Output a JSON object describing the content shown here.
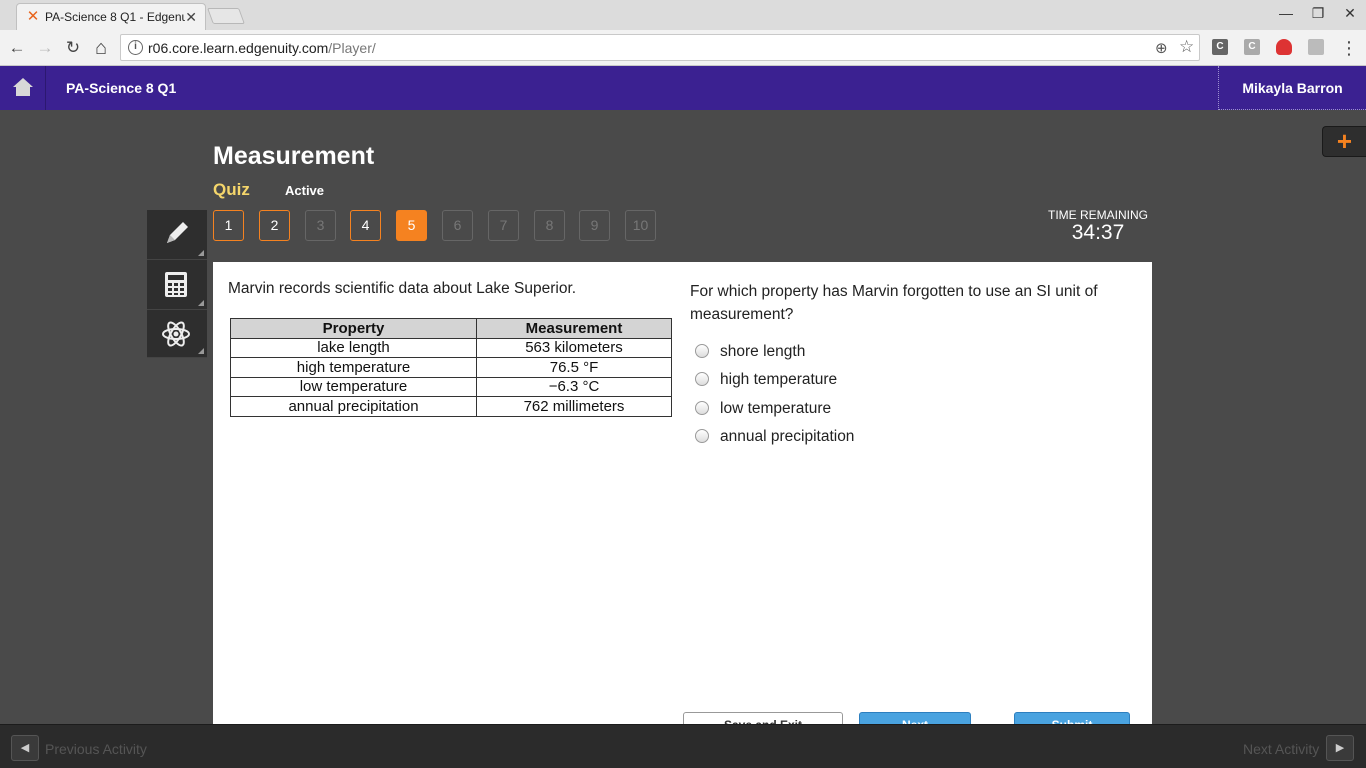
{
  "browser": {
    "tab_title": "PA-Science 8 Q1 - Edgenuity",
    "tab_close": "✕",
    "url_host": "r06.core.learn.edgenuity.com",
    "url_path": "/Player/",
    "back": "←",
    "forward": "→",
    "reload": "↻",
    "home": "⌂",
    "minimize": "—",
    "restore": "❐",
    "close": "✕",
    "zoom": "⊕",
    "star": "☆",
    "menu": "⋮",
    "ext1": "C",
    "ext2": "C"
  },
  "app": {
    "course_title": "PA-Science 8 Q1",
    "user_name": "Mikayla Barron",
    "plus": "+"
  },
  "activity": {
    "title": "Measurement",
    "type": "Quiz",
    "status": "Active",
    "questions": [
      {
        "label": "1",
        "state": "answered"
      },
      {
        "label": "2",
        "state": "answered"
      },
      {
        "label": "3",
        "state": "locked"
      },
      {
        "label": "4",
        "state": "answered"
      },
      {
        "label": "5",
        "state": "current"
      },
      {
        "label": "6",
        "state": "locked"
      },
      {
        "label": "7",
        "state": "locked"
      },
      {
        "label": "8",
        "state": "locked"
      },
      {
        "label": "9",
        "state": "locked"
      },
      {
        "label": "10",
        "state": "locked"
      }
    ],
    "time_label": "TIME REMAINING",
    "time_value": "34:37"
  },
  "tools": [
    "pencil-icon",
    "calculator-icon",
    "atom-icon"
  ],
  "question": {
    "stem": "Marvin records scientific data about Lake Superior.",
    "table_headers": [
      "Property",
      "Measurement"
    ],
    "table_rows": [
      [
        "lake length",
        "563 kilometers"
      ],
      [
        "high temperature",
        "76.5 °F"
      ],
      [
        "low temperature",
        "−6.3 °C"
      ],
      [
        "annual precipitation",
        "762 millimeters"
      ]
    ],
    "prompt": "For which property has Marvin forgotten to use an SI unit of measurement?",
    "choices": [
      "shore length",
      "high temperature",
      "low temperature",
      "annual precipitation"
    ]
  },
  "footer": {
    "previous": "Previous Activity",
    "next": "Next Activity",
    "prev_arrow": "◀",
    "next_arrow": "▶"
  },
  "bottom_buttons": {
    "save": "Save and Exit",
    "next": "Next",
    "submit": "Submit"
  }
}
